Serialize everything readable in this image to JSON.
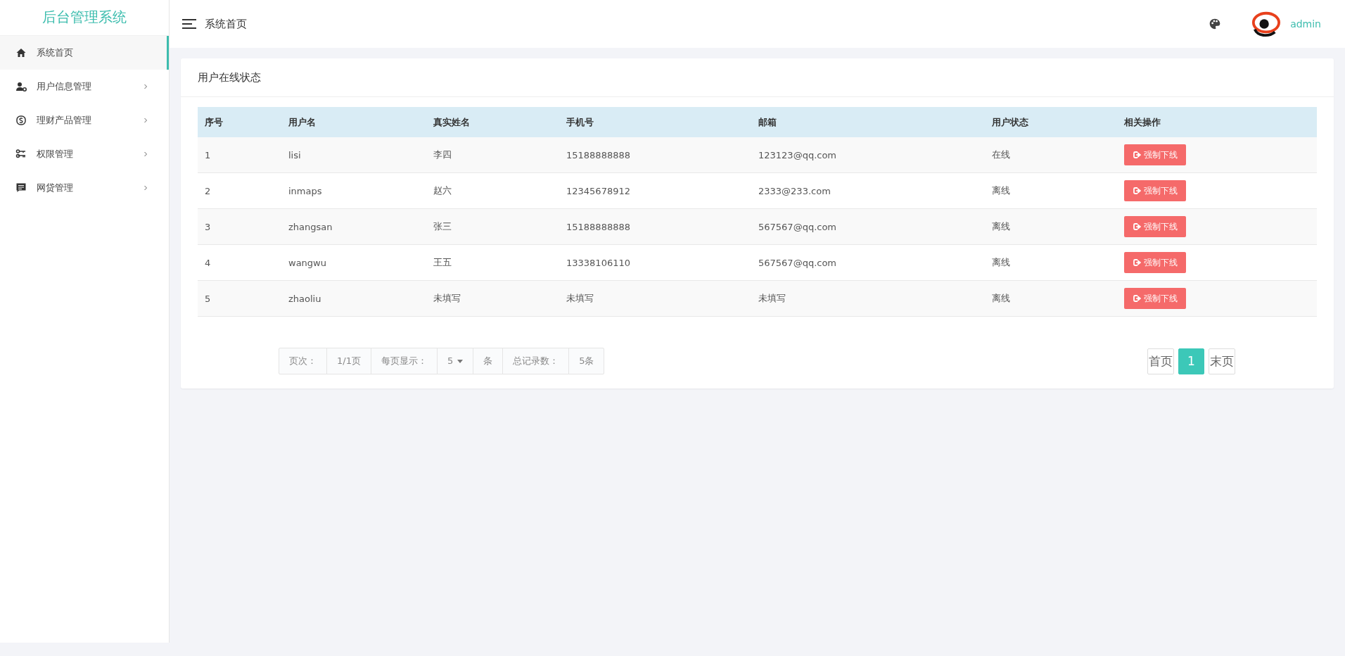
{
  "sidebar": {
    "title": "后台管理系统",
    "items": [
      {
        "label": "系统首页",
        "selected": true,
        "has_submenu": false
      },
      {
        "label": "用户信息管理",
        "selected": false,
        "has_submenu": true
      },
      {
        "label": "理财产品管理",
        "selected": false,
        "has_submenu": true
      },
      {
        "label": "权限管理",
        "selected": false,
        "has_submenu": true
      },
      {
        "label": "网贷管理",
        "selected": false,
        "has_submenu": true
      }
    ]
  },
  "header": {
    "breadcrumb": "系统首页",
    "username": "admin"
  },
  "card": {
    "title": "用户在线状态"
  },
  "table": {
    "columns": [
      "序号",
      "用户名",
      "真实姓名",
      "手机号",
      "邮箱",
      "用户状态",
      "相关操作"
    ],
    "rows": [
      {
        "cells": [
          "1",
          "lisi",
          "李四",
          "15188888888",
          "123123@qq.com",
          "在线"
        ],
        "action": "强制下线"
      },
      {
        "cells": [
          "2",
          "inmaps",
          "赵六",
          "12345678912",
          "2333@233.com",
          "离线"
        ],
        "action": "强制下线"
      },
      {
        "cells": [
          "3",
          "zhangsan",
          "张三",
          "15188888888",
          "567567@qq.com",
          "离线"
        ],
        "action": "强制下线"
      },
      {
        "cells": [
          "4",
          "wangwu",
          "王五",
          "13338106110",
          "567567@qq.com",
          "离线"
        ],
        "action": "强制下线"
      },
      {
        "cells": [
          "5",
          "zhaoliu",
          "未填写",
          "未填写",
          "未填写",
          "离线"
        ],
        "action": "强制下线"
      }
    ]
  },
  "pagination": {
    "info": [
      {
        "kind": "label",
        "text": "页次："
      },
      {
        "kind": "value",
        "text": "1/1页"
      },
      {
        "kind": "label",
        "text": "每页显示："
      },
      {
        "kind": "select",
        "text": "5"
      },
      {
        "kind": "label",
        "text": "条"
      },
      {
        "kind": "label",
        "text": "总记录数："
      },
      {
        "kind": "value",
        "text": "5条"
      }
    ],
    "pages": [
      {
        "label": "首页",
        "selected": false
      },
      {
        "label": "1",
        "selected": true
      },
      {
        "label": "末页",
        "selected": false
      }
    ]
  }
}
